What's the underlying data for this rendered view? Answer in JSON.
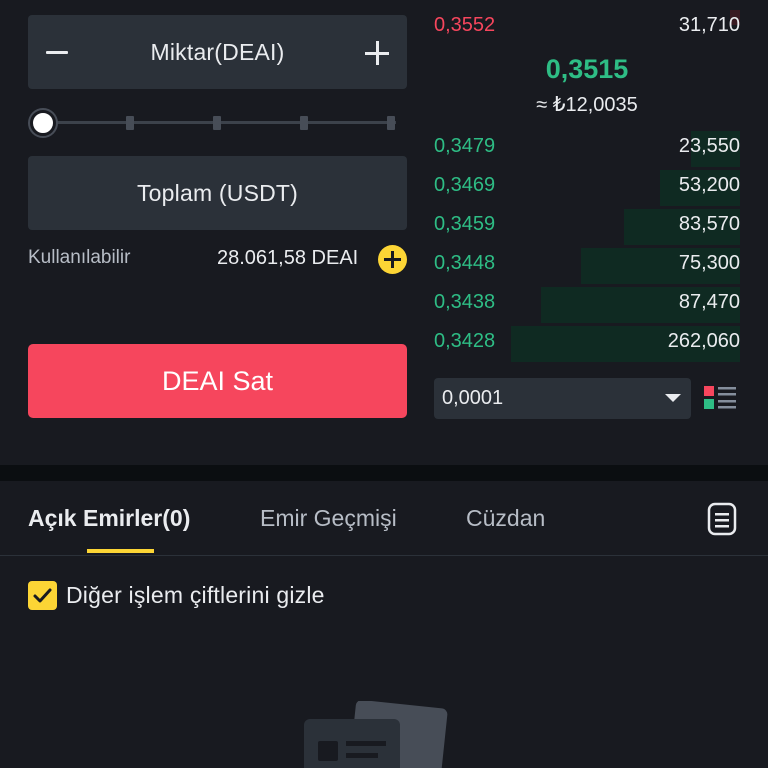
{
  "trade_form": {
    "quantity_placeholder": "Miktar(DEAI)",
    "total_placeholder": "Toplam (USDT)",
    "slider_percent": 0,
    "available_label": "Kullanılabilir",
    "available_value": "28.061,58 DEAI",
    "sell_button_label": "DEAI Sat"
  },
  "order_book": {
    "asks": [
      {
        "price": "0,3552",
        "amount": "31,710"
      }
    ],
    "mid_price": "0,3515",
    "mid_price_fiat": "≈ ₺12,0035",
    "bids": [
      {
        "price": "0,3479",
        "amount": "23,550",
        "depth": 0.16
      },
      {
        "price": "0,3469",
        "amount": "53,200",
        "depth": 0.26
      },
      {
        "price": "0,3459",
        "amount": "83,570",
        "depth": 0.38
      },
      {
        "price": "0,3448",
        "amount": "75,300",
        "depth": 0.52
      },
      {
        "price": "0,3438",
        "amount": "87,470",
        "depth": 0.65
      },
      {
        "price": "0,3428",
        "amount": "262,060",
        "depth": 0.75
      }
    ],
    "precision_value": "0,0001"
  },
  "orders_panel": {
    "tabs": [
      {
        "label": "Açık Emirler(0)",
        "active": true
      },
      {
        "label": "Emir Geçmişi",
        "active": false
      },
      {
        "label": "Cüzdan",
        "active": false
      }
    ],
    "hide_other_pairs_label": "Diğer işlem çiftlerini gizle",
    "hide_other_pairs_checked": true
  },
  "colors": {
    "accent": "#fcd535",
    "sell": "#f6465d",
    "buy": "#2ebd85",
    "background": "#181a20"
  },
  "icons": [
    "minus-icon",
    "plus-icon",
    "add-circle-icon",
    "caret-down-icon",
    "orderbook-layout-icon",
    "document-icon",
    "checkmark-icon"
  ]
}
